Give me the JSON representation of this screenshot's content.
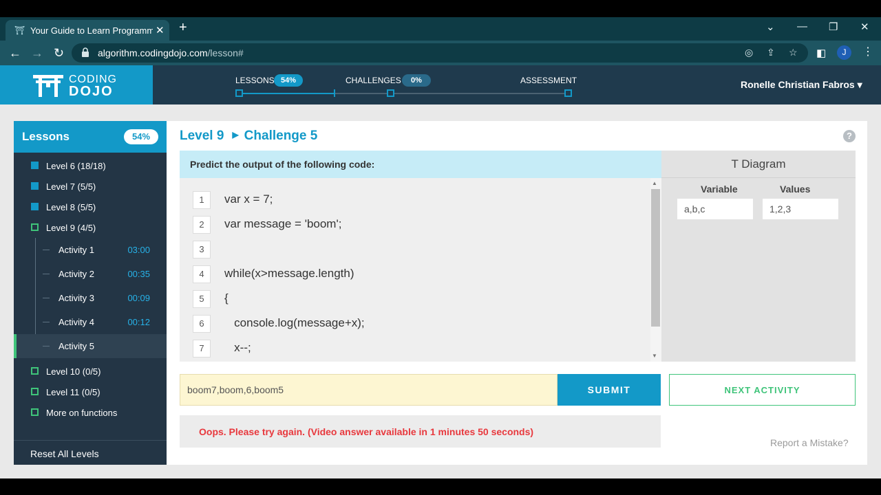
{
  "browser": {
    "tab_title": "Your Guide to Learn Programming",
    "tab_close": "✕",
    "new_tab": "+",
    "url_domain": "algorithm.codingdojo.com",
    "url_path": "/lesson#",
    "profile_initial": "J"
  },
  "header": {
    "logo_line1": "CODING",
    "logo_line2": "DOJO",
    "progress": [
      {
        "label": "LESSONS",
        "badge": "54%"
      },
      {
        "label": "CHALLENGES",
        "badge": "0%"
      },
      {
        "label": "ASSESSMENT",
        "badge": ""
      }
    ],
    "lessons_progress_fraction": 0.54,
    "user_name": "Ronelle Christian Fabros",
    "user_caret": "▾"
  },
  "sidebar": {
    "title": "Lessons",
    "percent": "54%",
    "levels_top": [
      {
        "label": "Level 6 (18/18)",
        "state": "done"
      },
      {
        "label": "Level 7 (5/5)",
        "state": "done"
      },
      {
        "label": "Level 8 (5/5)",
        "state": "done"
      },
      {
        "label": "Level 9 (4/5)",
        "state": "open"
      }
    ],
    "activities": [
      {
        "label": "Activity 1",
        "time": "03:00"
      },
      {
        "label": "Activity 2",
        "time": "00:35"
      },
      {
        "label": "Activity 3",
        "time": "00:09"
      },
      {
        "label": "Activity 4",
        "time": "00:12"
      },
      {
        "label": "Activity 5",
        "time": ""
      }
    ],
    "levels_bottom": [
      {
        "label": "Level 10 (0/5)",
        "state": "open"
      },
      {
        "label": "Level 11 (0/5)",
        "state": "open"
      },
      {
        "label": "More on functions",
        "state": "open"
      }
    ],
    "reset_label": "Reset All Levels"
  },
  "main": {
    "breadcrumb_level": "Level 9",
    "breadcrumb_challenge": "Challenge 5",
    "help": "?",
    "prompt": "Predict the output of the following code:",
    "code_lines": [
      {
        "n": "1",
        "text": "var x = 7;"
      },
      {
        "n": "2",
        "text": "var message = 'boom';"
      },
      {
        "n": "3",
        "text": ""
      },
      {
        "n": "4",
        "text": "while(x>message.length)"
      },
      {
        "n": "5",
        "text": "{"
      },
      {
        "n": "6",
        "text": "   console.log(message+x);"
      },
      {
        "n": "7",
        "text": "   x--;"
      }
    ],
    "t_diagram": {
      "title": "T Diagram",
      "col_variable": "Variable",
      "col_values": "Values",
      "variable_value": "a,b,c",
      "values_value": "1,2,3"
    },
    "answer_value": "boom7,boom,6,boom5",
    "submit_label": "SUBMIT",
    "next_label": "NEXT ACTIVITY",
    "error_text": "Oops. Please try again. (Video answer available in 1 minutes 50 seconds)",
    "report_link": "Report a Mistake?"
  },
  "colors": {
    "brand_blue": "#1399c8",
    "header_dark": "#1f3a4d",
    "success_green": "#3fc47a",
    "error_red": "#e8383d"
  }
}
